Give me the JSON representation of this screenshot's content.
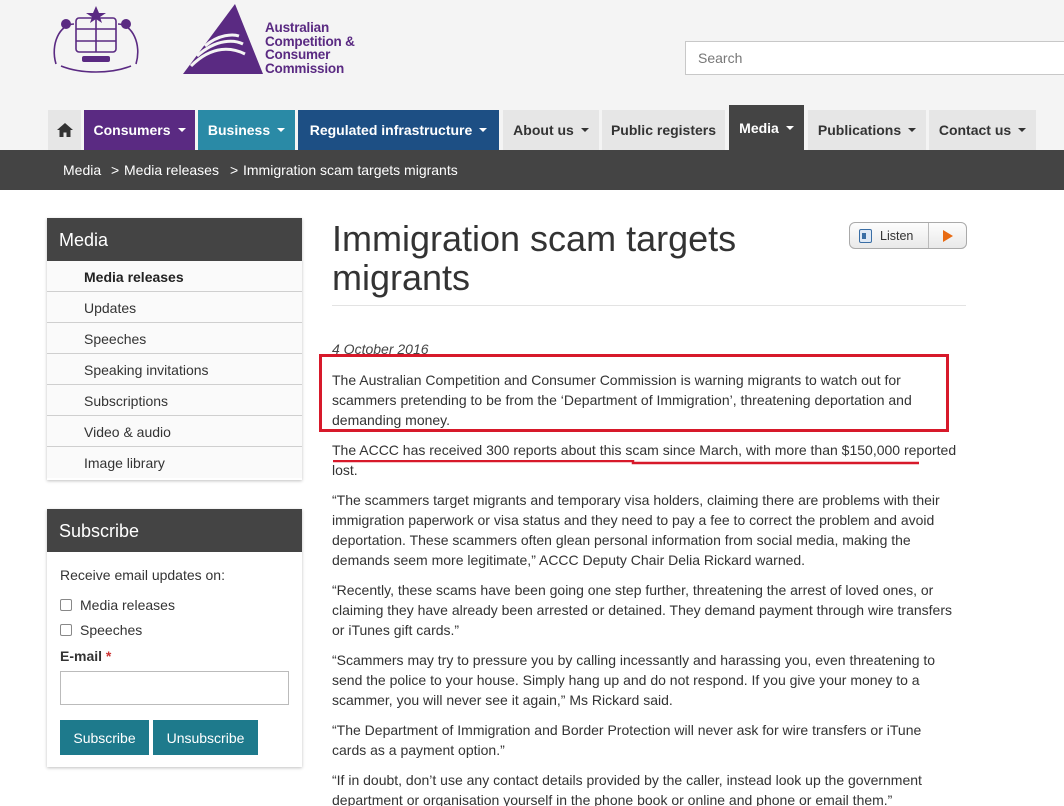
{
  "header": {
    "crest_name": "Commonwealth coat of arms",
    "org_name_lines": [
      "Australian",
      "Competition &",
      "Consumer",
      "Commission"
    ],
    "search_placeholder": "Search"
  },
  "nav": [
    {
      "label": "",
      "icon": "home-icon",
      "has_caret": false
    },
    {
      "label": "Consumers",
      "has_caret": true
    },
    {
      "label": "Business",
      "has_caret": true
    },
    {
      "label": "Regulated infrastructure",
      "has_caret": true
    },
    {
      "label": "About us",
      "has_caret": true
    },
    {
      "label": "Public registers",
      "has_caret": false
    },
    {
      "label": "Media",
      "has_caret": true
    },
    {
      "label": "Publications",
      "has_caret": true
    },
    {
      "label": "Contact us",
      "has_caret": true
    }
  ],
  "breadcrumb": [
    "Media",
    ">",
    "Media releases",
    ">",
    "Immigration scam targets migrants"
  ],
  "sidebar": {
    "title": "Media",
    "items": [
      "Media releases",
      "Updates",
      "Speeches",
      "Speaking invitations",
      "Subscriptions",
      "Video & audio",
      "Image library"
    ],
    "active_item": "Media releases"
  },
  "subscribe": {
    "title": "Subscribe",
    "prompt": "Receive email updates on:",
    "options": [
      "Media releases",
      "Speeches"
    ],
    "email_label": "E-mail",
    "required_mark": "*",
    "subscribe_label": "Subscribe",
    "unsubscribe_label": "Unsubscribe"
  },
  "article": {
    "title_lines": [
      "Immigration scam targets",
      "migrants"
    ],
    "listen_label": "Listen",
    "date": "4 October 2016",
    "paragraphs": [
      "The Australian Competition and Consumer Commission is warning migrants to watch out for scammers pretending to be from the ‘Department of Immigration’, threatening deportation and demanding money.",
      "The ACCC has received 300 reports about this scam since March, with more than $150,000 reported lost.",
      "“The scammers target migrants and temporary visa holders, claiming there are problems with their immigration paperwork or visa status and they need to pay a fee to correct the problem and avoid deportation. These scammers often glean personal information from social media, making the demands seem more legitimate,” ACCC Deputy Chair Delia Rickard warned.",
      "“Recently, these scams have been going one step further, threatening the arrest of loved ones, or claiming they have already been arrested or detained. They demand payment through wire transfers or iTunes gift cards.”",
      "“Scammers may try to pressure you by calling incessantly and harassing you, even threatening to send the police to your house. Simply hang up and do not respond. If you give your money to a scammer, you will never see it again,” Ms Rickard said.",
      "“The Department of Immigration and Border Protection will never ask for wire transfers or iTune cards as a payment option.”",
      "“If in doubt, don’t use any contact details provided by the caller, instead look up the government department or organisation yourself in the phone book or online and phone or email them.”"
    ]
  },
  "colors": {
    "consumers": "#5a2a82",
    "business": "#2a8aa6",
    "regulated": "#1d4f84",
    "media_active": "#444444",
    "button": "#1e7a8c",
    "annotation": "#d7192a"
  }
}
